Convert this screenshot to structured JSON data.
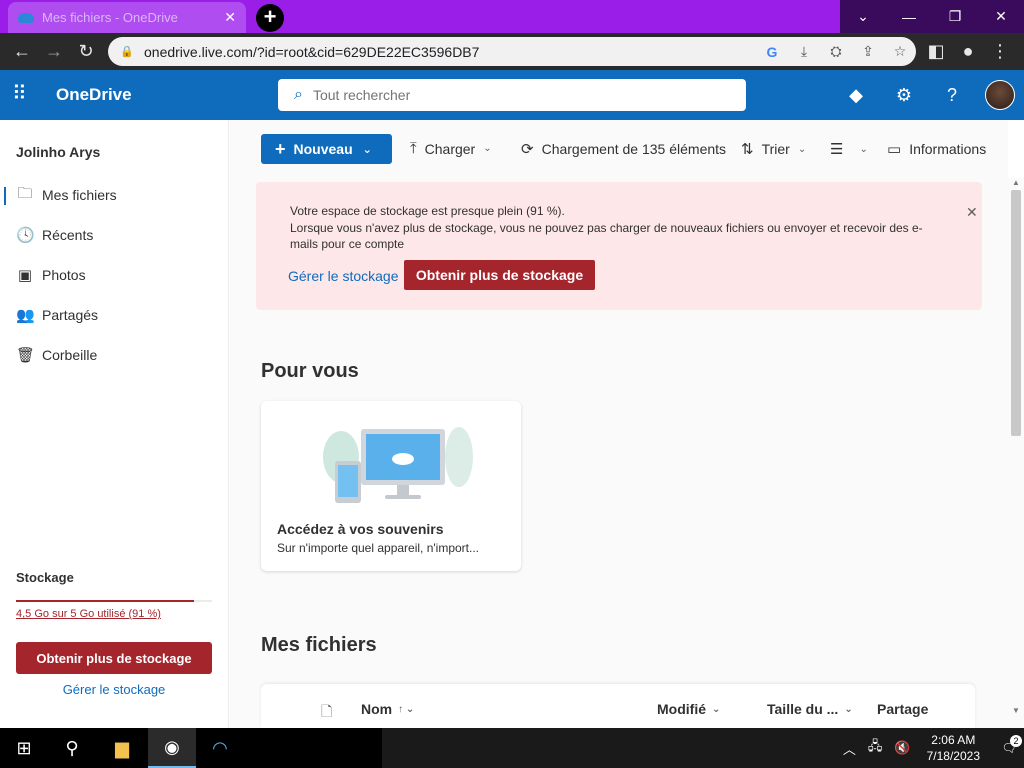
{
  "browser": {
    "tab_title": "Mes fichiers - OneDrive",
    "new_tab_label": "+",
    "url": "onedrive.live.com/?id=root&cid=629DE22EC3596DB7"
  },
  "header": {
    "brand": "OneDrive",
    "search_placeholder": "Tout rechercher"
  },
  "sidebar": {
    "user": "Jolinho Arys",
    "items": [
      {
        "label": "Mes fichiers",
        "icon": "folder-icon",
        "glyph": "🗀"
      },
      {
        "label": "Récents",
        "icon": "clock-icon",
        "glyph": "🕓"
      },
      {
        "label": "Photos",
        "icon": "image-icon",
        "glyph": "▣"
      },
      {
        "label": "Partagés",
        "icon": "people-icon",
        "glyph": "👥"
      },
      {
        "label": "Corbeille",
        "icon": "trash-icon",
        "glyph": "🗑"
      }
    ],
    "storage_title": "Stockage",
    "storage_used": "4,5 Go sur 5 Go utilisé (91 %)",
    "storage_fraction": 0.91,
    "cta": "Obtenir plus de stockage",
    "manage": "Gérer le stockage"
  },
  "commands": {
    "new": "Nouveau",
    "upload": "Charger",
    "loading": "Chargement de 135 éléments",
    "sort": "Trier",
    "info": "Informations"
  },
  "banner": {
    "title": "Votre espace de stockage est presque plein (91 %).",
    "text": "Lorsque vous n'avez plus de stockage, vous ne pouvez pas charger de nouveaux fichiers ou envoyer et recevoir des e-mails pour ce compte",
    "link": "Gérer le stockage",
    "cta": "Obtenir plus de stockage"
  },
  "for_you": {
    "heading": "Pour vous",
    "card_title": "Accédez à vos souvenirs",
    "card_subtitle": "Sur n'importe quel appareil, n'import..."
  },
  "files": {
    "heading": "Mes fichiers",
    "columns": {
      "name": "Nom",
      "modified": "Modifié",
      "size": "Taille du ...",
      "sharing": "Partage"
    }
  },
  "taskbar": {
    "time": "2:06 AM",
    "date": "7/18/2023",
    "notifications": "2"
  },
  "colors": {
    "brand": "#0f6cbd",
    "alert": "#a4262c",
    "banner_bg": "#fde7e9",
    "browser_frame": "#9b1ee8"
  }
}
